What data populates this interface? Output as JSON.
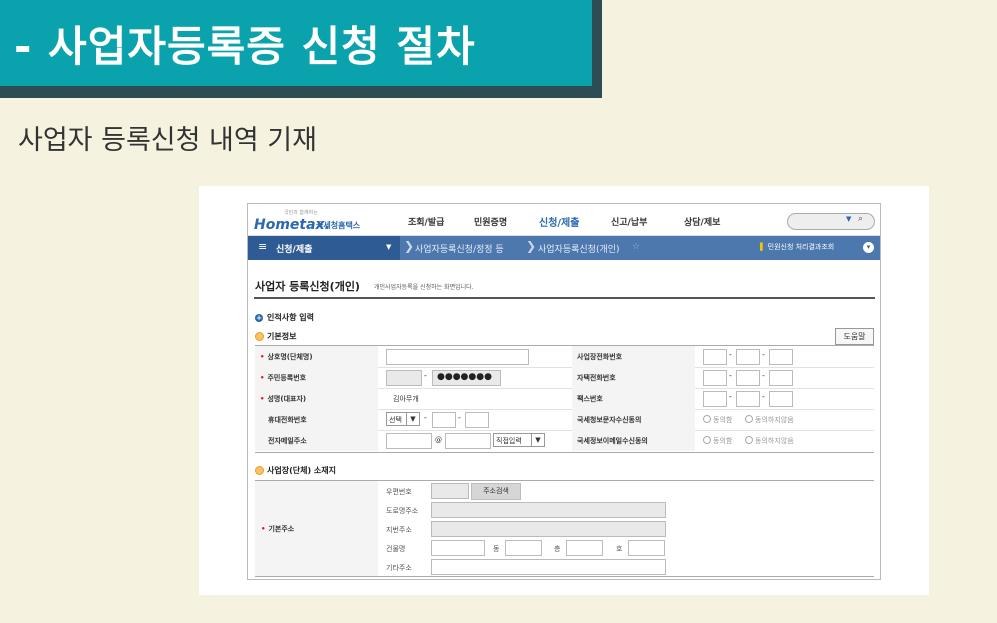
{
  "banner": {
    "title": "- 사업자등록증 신청 절차"
  },
  "subtitle": "사업자 등록신청 내역 기재",
  "app": {
    "logo": {
      "small_text": "국민과 함께하는",
      "brand": "Hometax.",
      "sub": "국세청홈택스"
    },
    "top_menu": [
      "조회/발급",
      "민원증명",
      "신청/제출",
      "신고/납부",
      "상담/제보"
    ],
    "search": {
      "placeholder": ""
    },
    "nav": {
      "current": "신청/제출",
      "crumbs": [
        "사업자등록신청/정정 등",
        "사업자등록신청(개인)"
      ],
      "right_link": "민원신청 처리결과조회"
    },
    "page": {
      "title": "사업자 등록신청(개인)",
      "description": "개인사업자등록을 신청하는 화면입니다.",
      "section_main": "인적사항 입력",
      "section_basic": "기본정보",
      "help_button": "도움말"
    },
    "form": {
      "rows": [
        {
          "left_label": "상호명(단체명)",
          "left_required": true,
          "right_label": "사업장전화번호"
        },
        {
          "left_label": "주민등록번호",
          "left_required": true,
          "masked_value": "●●●●●●●",
          "right_label": "자택전화번호"
        },
        {
          "left_label": "성명(대표자)",
          "left_required": true,
          "name_value": "김아무개",
          "right_label": "팩스번호"
        },
        {
          "left_label": "휴대전화번호",
          "left_required": false,
          "phone_select": "선택",
          "right_label": "국세청보문자수신동의",
          "radio_agree": "동의함",
          "radio_disagree": "동의하지않음"
        },
        {
          "left_label": "전자메일주소",
          "left_required": false,
          "email_at": "@",
          "email_select": "직접입력",
          "right_label": "국세정보이메일수신동의",
          "radio_agree": "동의함",
          "radio_disagree": "동의하지않음"
        }
      ]
    },
    "address": {
      "section_title": "사업장(단체) 소재지",
      "label": "기본주소",
      "zip_label": "우편번호",
      "zip_button": "주소검색",
      "road_label": "도로명주소",
      "lot_label": "지번주소",
      "building_label": "건물명",
      "dong_label": "동",
      "floor_label": "층",
      "ho_label": "호",
      "other_label": "기타주소"
    }
  },
  "colors": {
    "banner": "#0aa3ad",
    "banner_shadow": "#2e4c54",
    "nav": "#4d78ad",
    "nav_dark": "#2f5b94",
    "required": "#d21c1c"
  }
}
